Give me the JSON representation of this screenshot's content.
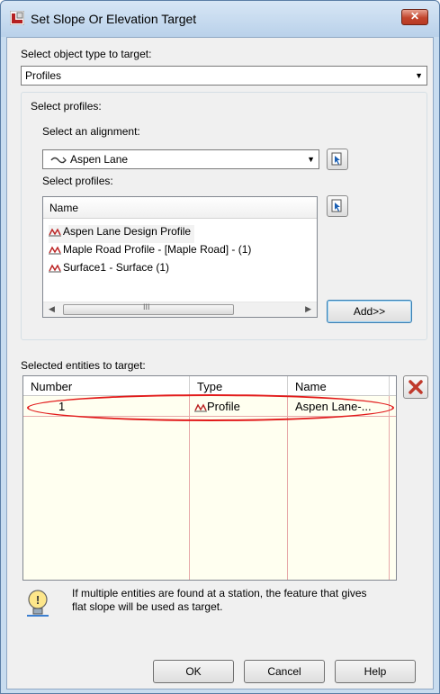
{
  "window": {
    "title": "Set Slope Or Elevation Target",
    "close_glyph": "✕"
  },
  "object_type": {
    "label": "Select object type to target:",
    "selected": "Profiles"
  },
  "profiles_group": {
    "title": "Select profiles:",
    "alignment_label": "Select an alignment:",
    "alignment_selected": "Aspen Lane",
    "profiles_label": "Select profiles:",
    "list_header": "Name",
    "profiles": [
      "Aspen Lane Design Profile",
      "Maple Road Profile - [Maple Road] -  (1)",
      "Surface1 - Surface (1)"
    ],
    "scroll_thumb_glyph": "III",
    "add_button": "Add>>"
  },
  "entities": {
    "label": "Selected entities to target:",
    "columns": [
      "Number",
      "Type",
      "Name"
    ],
    "rows": [
      {
        "number": "1",
        "type": "Profile",
        "name": "Aspen Lane-..."
      }
    ]
  },
  "info": {
    "message_line1": "If multiple entities are found at a station, the feature that gives",
    "message_line2": "flat slope will be used as target."
  },
  "buttons": {
    "ok": "OK",
    "cancel": "Cancel",
    "help": "Help"
  },
  "icons": {
    "app": "civil3d-app-icon",
    "pick": "pick-in-drawing-icon",
    "alignment": "alignment-icon",
    "profile": "profile-icon",
    "delete": "delete-x-icon",
    "info": "lightbulb-info-icon"
  },
  "colors": {
    "highlight_ellipse": "#e21b1b",
    "grid_background": "#fffff0",
    "delete_icon": "#c0392b"
  }
}
